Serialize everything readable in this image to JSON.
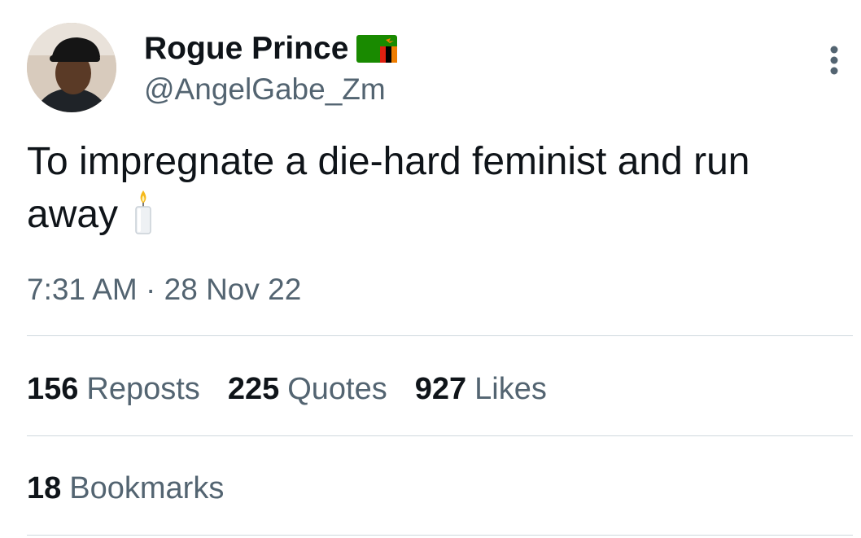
{
  "tweet": {
    "author": {
      "display_name": "Rogue Prince",
      "handle": "@AngelGabe_Zm",
      "flag_icon": "zambia-flag-icon"
    },
    "text": "To impregnate a die-hard feminist and run away",
    "emoji_icon": "candle-icon",
    "timestamp": "7:31 AM · 28 Nov 22"
  },
  "stats": [
    {
      "count": "156",
      "label": "Reposts"
    },
    {
      "count": "225",
      "label": "Quotes"
    },
    {
      "count": "927",
      "label": "Likes"
    }
  ],
  "bookmarks": {
    "count": "18",
    "label": "Bookmarks"
  },
  "colors": {
    "text_primary": "#0f1419",
    "text_secondary": "#536471",
    "divider": "#cfd9de"
  }
}
